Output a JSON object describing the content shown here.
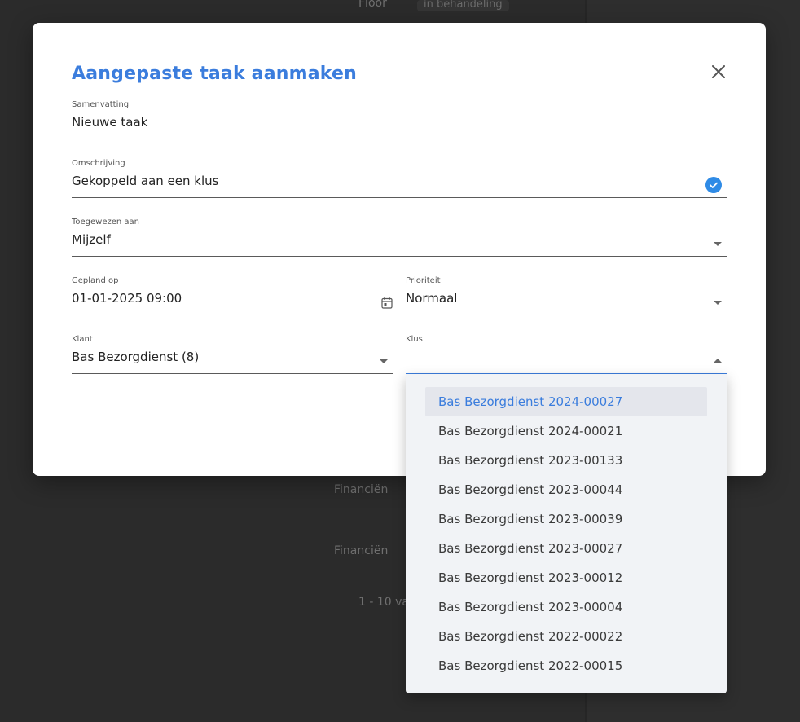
{
  "background": {
    "texts": [
      "Floor",
      "in behandeling",
      "Financiën",
      "Financiën",
      "1 - 10 van"
    ]
  },
  "modal": {
    "title": "Aangepaste taak aanmaken",
    "close_icon": "close-icon",
    "fields": {
      "summary": {
        "label": "Samenvatting",
        "value": "Nieuwe taak"
      },
      "description": {
        "label": "Omschrijving",
        "value": "Gekoppeld aan een klus"
      },
      "assigned": {
        "label": "Toegewezen aan",
        "value": "Mijzelf"
      },
      "planned": {
        "label": "Gepland op",
        "value": "01-01-2025 09:00"
      },
      "priority": {
        "label": "Prioriteit",
        "value": "Normaal"
      },
      "customer": {
        "label": "Klant",
        "value": "Bas Bezorgdienst (8)"
      },
      "job": {
        "label": "Klus",
        "value": ""
      }
    }
  },
  "dropdown": {
    "items": [
      "Bas Bezorgdienst 2024-00027",
      "Bas Bezorgdienst 2024-00021",
      "Bas Bezorgdienst 2023-00133",
      "Bas Bezorgdienst 2023-00044",
      "Bas Bezorgdienst 2023-00039",
      "Bas Bezorgdienst 2023-00027",
      "Bas Bezorgdienst 2023-00012",
      "Bas Bezorgdienst 2023-00004",
      "Bas Bezorgdienst 2022-00022",
      "Bas Bezorgdienst 2022-00015"
    ]
  },
  "colors": {
    "accent": "#3b7ddd",
    "check": "#2f8be6"
  }
}
